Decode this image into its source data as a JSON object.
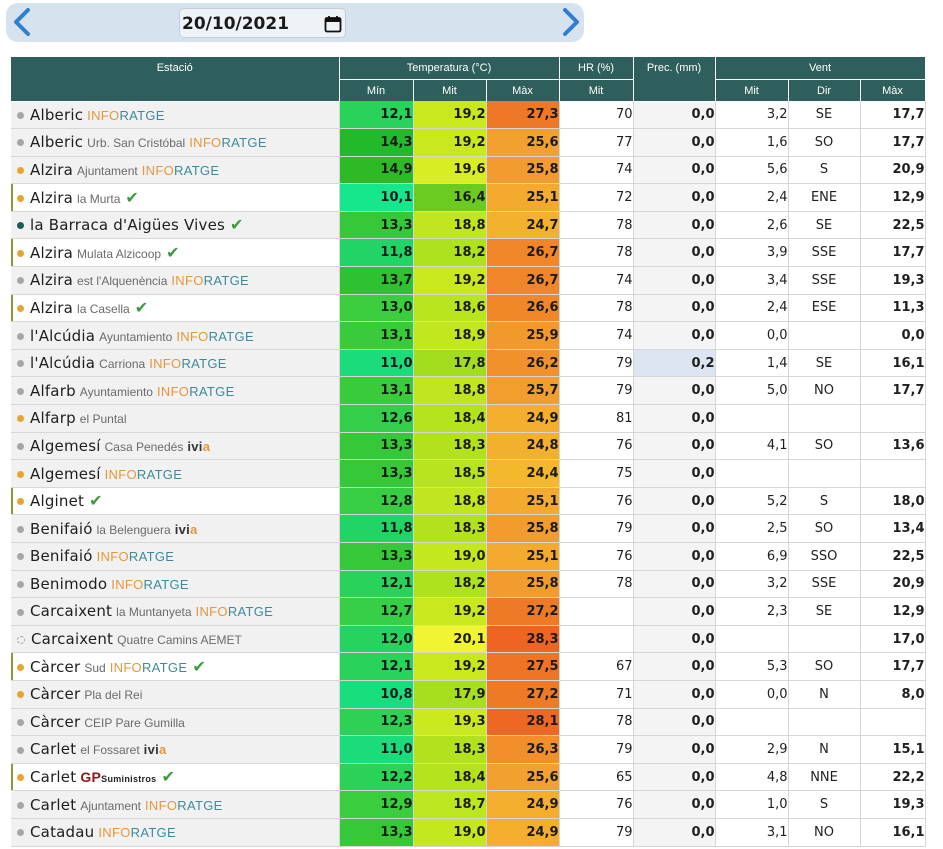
{
  "date": "20/10/2021",
  "icons": {
    "prev": "chevron-left-icon",
    "next": "chevron-right-icon",
    "calendar": "calendar-icon",
    "verified": "check-icon"
  },
  "colors": {
    "header_bg": "#2f5f5c",
    "topbar_bg": "#d6e3ef",
    "official_dot": "#e6a531",
    "other_dot": "#a6a6a6"
  },
  "headers": {
    "station": "Estació",
    "temperature": "Temperatura (°C)",
    "humidity": "HR (%)",
    "precipitation": "Prec. (mm)",
    "wind": "Vent",
    "min": "Mín",
    "mit": "Mit",
    "max": "Màx",
    "hum_mit": "Mit",
    "wind_mit": "Mit",
    "wind_dir": "Dir",
    "wind_max": "Màx"
  },
  "stations": [
    {
      "name": "Alberic",
      "sub": "",
      "brand": "infor",
      "dot": "grey",
      "check": false,
      "official": false,
      "tmin": "12,1",
      "tmit": "19,2",
      "tmax": "27,3",
      "hr": "70",
      "prec": "0,0",
      "wmit": "3,2",
      "wdir": "SE",
      "wmax": "17,7"
    },
    {
      "name": "Alberic",
      "sub": "Urb. San Cristóbal",
      "brand": "infor",
      "dot": "grey",
      "check": false,
      "official": false,
      "tmin": "14,3",
      "tmit": "19,2",
      "tmax": "25,6",
      "hr": "77",
      "prec": "0,0",
      "wmit": "1,6",
      "wdir": "SO",
      "wmax": "17,7"
    },
    {
      "name": "Alzira",
      "sub": "Ajuntament",
      "brand": "infor",
      "dot": "orange",
      "check": false,
      "official": false,
      "tmin": "14,9",
      "tmit": "19,6",
      "tmax": "25,8",
      "hr": "74",
      "prec": "0,0",
      "wmit": "5,6",
      "wdir": "S",
      "wmax": "20,9"
    },
    {
      "name": "Alzira",
      "sub": "la Murta",
      "brand": "",
      "dot": "orange",
      "check": true,
      "official": true,
      "tmin": "10,1",
      "tmit": "16,4",
      "tmax": "25,1",
      "hr": "72",
      "prec": "0,0",
      "wmit": "2,4",
      "wdir": "ENE",
      "wmax": "12,9"
    },
    {
      "name": "la Barraca d'Aigües Vives",
      "sub": "",
      "brand": "",
      "dot": "teal",
      "check": true,
      "official": false,
      "tmin": "13,3",
      "tmit": "18,8",
      "tmax": "24,7",
      "hr": "78",
      "prec": "0,0",
      "wmit": "2,6",
      "wdir": "SE",
      "wmax": "22,5"
    },
    {
      "name": "Alzira",
      "sub": "Mulata Alzicoop",
      "brand": "",
      "dot": "orange",
      "check": true,
      "official": true,
      "tmin": "11,8",
      "tmit": "18,2",
      "tmax": "26,7",
      "hr": "78",
      "prec": "0,0",
      "wmit": "3,9",
      "wdir": "SSE",
      "wmax": "17,7"
    },
    {
      "name": "Alzira",
      "sub": "est l'Alquenència",
      "brand": "infor",
      "dot": "grey",
      "check": false,
      "official": false,
      "tmin": "13,7",
      "tmit": "19,2",
      "tmax": "26,7",
      "hr": "74",
      "prec": "0,0",
      "wmit": "3,4",
      "wdir": "SSE",
      "wmax": "19,3"
    },
    {
      "name": "Alzira",
      "sub": "la Casella",
      "brand": "",
      "dot": "orange",
      "check": true,
      "official": true,
      "tmin": "13,0",
      "tmit": "18,6",
      "tmax": "26,6",
      "hr": "78",
      "prec": "0,0",
      "wmit": "2,4",
      "wdir": "ESE",
      "wmax": "11,3"
    },
    {
      "name": "l'Alcúdia",
      "sub": "Ayuntamiento",
      "brand": "infor",
      "dot": "grey",
      "check": false,
      "official": false,
      "tmin": "13,1",
      "tmit": "18,9",
      "tmax": "25,9",
      "hr": "74",
      "prec": "0,0",
      "wmit": "0,0",
      "wdir": "",
      "wmax": "0,0"
    },
    {
      "name": "l'Alcúdia",
      "sub": "Carriona",
      "brand": "infor",
      "dot": "grey",
      "check": false,
      "official": false,
      "tmin": "11,0",
      "tmit": "17,8",
      "tmax": "26,2",
      "hr": "79",
      "prec": "0,2",
      "wmit": "1,4",
      "wdir": "SE",
      "wmax": "16,1"
    },
    {
      "name": "Alfarb",
      "sub": "Ayuntamiento",
      "brand": "infor",
      "dot": "grey",
      "check": false,
      "official": false,
      "tmin": "13,1",
      "tmit": "18,8",
      "tmax": "25,7",
      "hr": "79",
      "prec": "0,0",
      "wmit": "5,0",
      "wdir": "NO",
      "wmax": "17,7"
    },
    {
      "name": "Alfarp",
      "sub": "el Puntal",
      "brand": "",
      "dot": "orange",
      "check": false,
      "official": false,
      "tmin": "12,6",
      "tmit": "18,4",
      "tmax": "24,9",
      "hr": "81",
      "prec": "0,0",
      "wmit": "",
      "wdir": "",
      "wmax": ""
    },
    {
      "name": "Algemesí",
      "sub": "Casa Penedés",
      "brand": "ivia",
      "dot": "grey",
      "check": false,
      "official": false,
      "tmin": "13,3",
      "tmit": "18,3",
      "tmax": "24,8",
      "hr": "76",
      "prec": "0,0",
      "wmit": "4,1",
      "wdir": "SO",
      "wmax": "13,6"
    },
    {
      "name": "Algemesí",
      "sub": "",
      "brand": "infor",
      "dot": "orange",
      "check": false,
      "official": false,
      "tmin": "13,3",
      "tmit": "18,5",
      "tmax": "24,4",
      "hr": "75",
      "prec": "0,0",
      "wmit": "",
      "wdir": "",
      "wmax": ""
    },
    {
      "name": "Alginet",
      "sub": "",
      "brand": "",
      "dot": "orange",
      "check": true,
      "official": true,
      "tmin": "12,8",
      "tmit": "18,8",
      "tmax": "25,1",
      "hr": "76",
      "prec": "0,0",
      "wmit": "5,2",
      "wdir": "S",
      "wmax": "18,0"
    },
    {
      "name": "Benifaió",
      "sub": "la Belenguera",
      "brand": "ivia",
      "dot": "grey",
      "check": false,
      "official": false,
      "tmin": "11,8",
      "tmit": "18,3",
      "tmax": "25,8",
      "hr": "79",
      "prec": "0,0",
      "wmit": "2,5",
      "wdir": "SO",
      "wmax": "13,4"
    },
    {
      "name": "Benifaió",
      "sub": "",
      "brand": "infor",
      "dot": "grey",
      "check": false,
      "official": false,
      "tmin": "13,3",
      "tmit": "19,0",
      "tmax": "25,1",
      "hr": "76",
      "prec": "0,0",
      "wmit": "6,9",
      "wdir": "SSO",
      "wmax": "22,5"
    },
    {
      "name": "Benimodo",
      "sub": "",
      "brand": "infor",
      "dot": "grey",
      "check": false,
      "official": false,
      "tmin": "12,1",
      "tmit": "18,2",
      "tmax": "25,8",
      "hr": "78",
      "prec": "0,0",
      "wmit": "3,2",
      "wdir": "SSE",
      "wmax": "20,9"
    },
    {
      "name": "Carcaixent",
      "sub": "la Muntanyeta",
      "brand": "infor",
      "dot": "grey",
      "check": false,
      "official": false,
      "tmin": "12,7",
      "tmit": "19,2",
      "tmax": "27,2",
      "hr": "",
      "prec": "0,0",
      "wmit": "2,3",
      "wdir": "SE",
      "wmax": "12,9"
    },
    {
      "name": "Carcaixent",
      "sub": "Quatre Camins AEMET",
      "brand": "",
      "dot": "hollow",
      "check": false,
      "official": false,
      "tmin": "12,0",
      "tmit": "20,1",
      "tmax": "28,3",
      "hr": "",
      "prec": "0,0",
      "wmit": "",
      "wdir": "",
      "wmax": "17,0"
    },
    {
      "name": "Càrcer",
      "sub": "Sud",
      "brand": "infor",
      "dot": "orange",
      "check": true,
      "official": true,
      "tmin": "12,1",
      "tmit": "19,2",
      "tmax": "27,5",
      "hr": "67",
      "prec": "0,0",
      "wmit": "5,3",
      "wdir": "SO",
      "wmax": "17,7"
    },
    {
      "name": "Càrcer",
      "sub": "Pla del Rei",
      "brand": "",
      "dot": "orange",
      "check": false,
      "official": false,
      "tmin": "10,8",
      "tmit": "17,9",
      "tmax": "27,2",
      "hr": "71",
      "prec": "0,0",
      "wmit": "0,0",
      "wdir": "N",
      "wmax": "8,0"
    },
    {
      "name": "Càrcer",
      "sub": "CEIP Pare Gumilla",
      "brand": "",
      "dot": "grey",
      "check": false,
      "official": false,
      "tmin": "12,3",
      "tmit": "19,3",
      "tmax": "28,1",
      "hr": "78",
      "prec": "0,0",
      "wmit": "",
      "wdir": "",
      "wmax": ""
    },
    {
      "name": "Carlet",
      "sub": "el Fossaret",
      "brand": "ivia",
      "dot": "grey",
      "check": false,
      "official": false,
      "tmin": "11,0",
      "tmit": "18,3",
      "tmax": "26,3",
      "hr": "79",
      "prec": "0,0",
      "wmit": "2,9",
      "wdir": "N",
      "wmax": "15,1"
    },
    {
      "name": "Carlet",
      "sub": "",
      "brand": "gp",
      "dot": "orange",
      "check": true,
      "official": true,
      "tmin": "12,2",
      "tmit": "18,4",
      "tmax": "25,6",
      "hr": "65",
      "prec": "0,0",
      "wmit": "4,8",
      "wdir": "NNE",
      "wmax": "22,2"
    },
    {
      "name": "Carlet",
      "sub": "Ajuntament",
      "brand": "infor",
      "dot": "grey",
      "check": false,
      "official": false,
      "tmin": "12,9",
      "tmit": "18,7",
      "tmax": "24,9",
      "hr": "76",
      "prec": "0,0",
      "wmit": "1,0",
      "wdir": "S",
      "wmax": "19,3"
    },
    {
      "name": "Catadau",
      "sub": "",
      "brand": "infor",
      "dot": "grey",
      "check": false,
      "official": false,
      "tmin": "13,3",
      "tmit": "19,0",
      "tmax": "24,9",
      "hr": "79",
      "prec": "0,0",
      "wmit": "3,1",
      "wdir": "NO",
      "wmax": "16,1"
    }
  ],
  "brands": {
    "infor_a": "INFO",
    "infor_b": "RATGE",
    "ivia_a": "ivi",
    "ivia_b": "a",
    "gp_a": "GP",
    "gp_b": "Suministros"
  }
}
